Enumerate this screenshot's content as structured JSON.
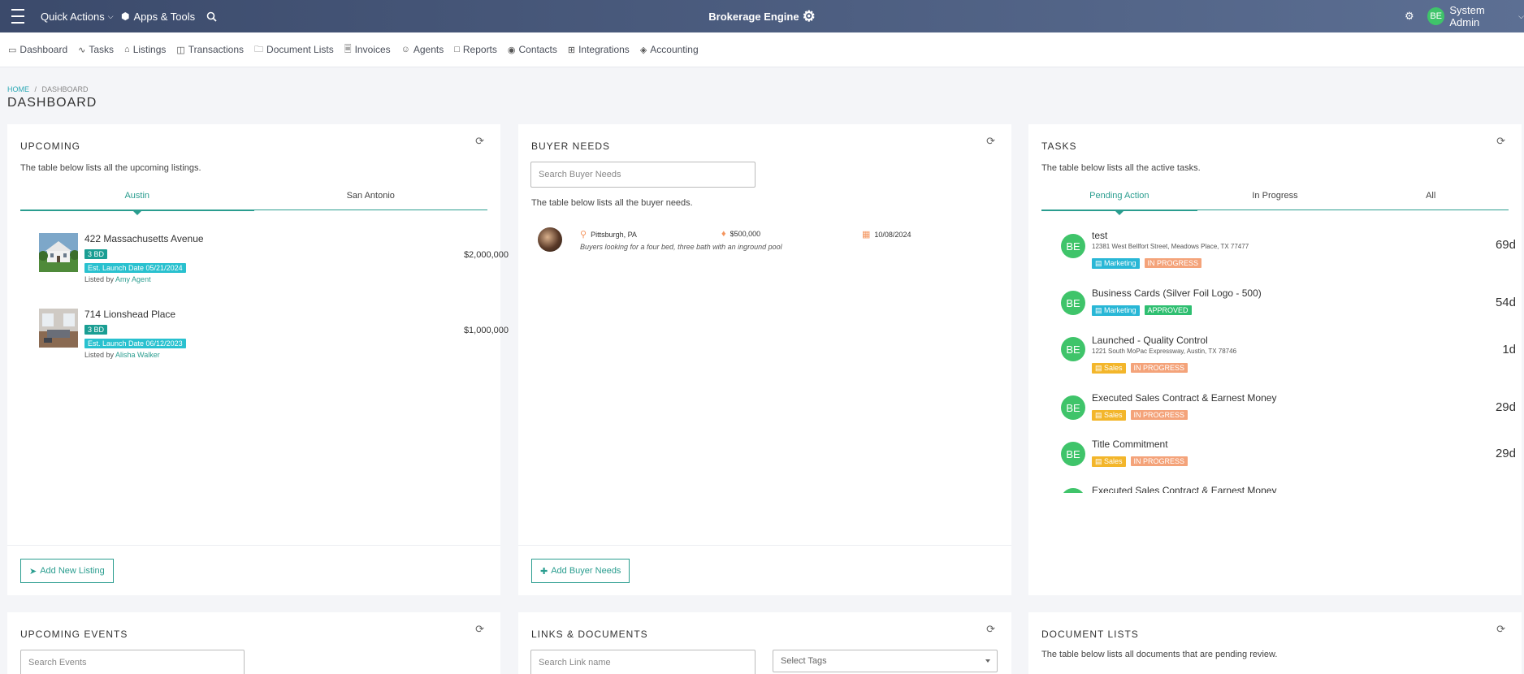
{
  "topbar": {
    "quick_actions": "Quick Actions",
    "apps_tools": "Apps & Tools",
    "brand": "Brokerage Engine",
    "user_initials": "BE",
    "user_name": "System Admin"
  },
  "nav": [
    {
      "label": "Dashboard",
      "icon": "monitor-icon"
    },
    {
      "label": "Tasks",
      "icon": "pulse-icon"
    },
    {
      "label": "Listings",
      "icon": "home-icon"
    },
    {
      "label": "Transactions",
      "icon": "columns-icon"
    },
    {
      "label": "Document Lists",
      "icon": "folder-icon"
    },
    {
      "label": "Invoices",
      "icon": "file-icon"
    },
    {
      "label": "Agents",
      "icon": "user-icon"
    },
    {
      "label": "Reports",
      "icon": "bar-chart-icon"
    },
    {
      "label": "Contacts",
      "icon": "globe-icon"
    },
    {
      "label": "Integrations",
      "icon": "grid-icon"
    },
    {
      "label": "Accounting",
      "icon": "layers-icon"
    }
  ],
  "breadcrumb": {
    "home": "HOME",
    "sep": "/",
    "current": "DASHBOARD"
  },
  "page_title": "DASHBOARD",
  "upcoming": {
    "title": "UPCOMING",
    "subtitle": "The table below lists all the upcoming listings.",
    "tabs": [
      "Austin",
      "San Antonio"
    ],
    "listings": [
      {
        "address": "422 Massachusetts Avenue",
        "beds": "3 BD",
        "launch": "Est. Launch Date 05/21/2024",
        "listed_by": "Listed by",
        "agent": "Amy Agent",
        "price": "$2,000,000"
      },
      {
        "address": "714 Lionshead Place",
        "beds": "3 BD",
        "launch": "Est. Launch Date 06/12/2023",
        "listed_by": "Listed by",
        "agent": "Alisha Walker",
        "price": "$1,000,000"
      }
    ],
    "button": "Add New Listing"
  },
  "buyer_needs": {
    "title": "BUYER NEEDS",
    "search_placeholder": "Search Buyer Needs",
    "subtitle": "The table below lists all the buyer needs.",
    "rows": [
      {
        "location": "Pittsburgh, PA",
        "price": "$500,000",
        "date": "10/08/2024",
        "note": "Buyers looking for a four bed, three bath with an inground pool"
      }
    ],
    "button": "Add Buyer Needs"
  },
  "tasks": {
    "title": "TASKS",
    "subtitle": "The table below lists all the active tasks.",
    "tabs": [
      "Pending Action",
      "In Progress",
      "All"
    ],
    "items": [
      {
        "initials": "BE",
        "title": "test",
        "address": "12381 West Bellfort Street, Meadows Place, TX 77477",
        "category": "Marketing",
        "status": "IN PROGRESS",
        "days": "69d"
      },
      {
        "initials": "BE",
        "title": "Business Cards (Silver Foil Logo - 500)",
        "address": "",
        "category": "Marketing",
        "status": "APPROVED",
        "days": "54d"
      },
      {
        "initials": "BE",
        "title": "Launched - Quality Control",
        "address": "1221 South MoPac Expressway, Austin, TX 78746",
        "category": "Sales",
        "status": "IN PROGRESS",
        "days": "1d"
      },
      {
        "initials": "BE",
        "title": "Executed Sales Contract & Earnest Money",
        "address": "",
        "category": "Sales",
        "status": "IN PROGRESS",
        "days": "29d"
      },
      {
        "initials": "BE",
        "title": "Title Commitment",
        "address": "",
        "category": "Sales",
        "status": "IN PROGRESS",
        "days": "29d"
      },
      {
        "initials": "BE",
        "title": "Executed Sales Contract & Earnest Money",
        "address": "",
        "category": "",
        "status": "",
        "days": ""
      }
    ]
  },
  "upcoming_events": {
    "title": "UPCOMING EVENTS",
    "search_placeholder": "Search Events"
  },
  "links_documents": {
    "title": "LINKS & DOCUMENTS",
    "search_placeholder": "Search Link name",
    "tags_placeholder": "Select Tags"
  },
  "document_lists": {
    "title": "DOCUMENT LISTS",
    "subtitle": "The table below lists all documents that are pending review."
  },
  "colors": {
    "accent": "#2a9d8f",
    "topbar_start": "#3b4a6b",
    "topbar_end": "#5c6f93",
    "avatar": "#3fc46a"
  }
}
